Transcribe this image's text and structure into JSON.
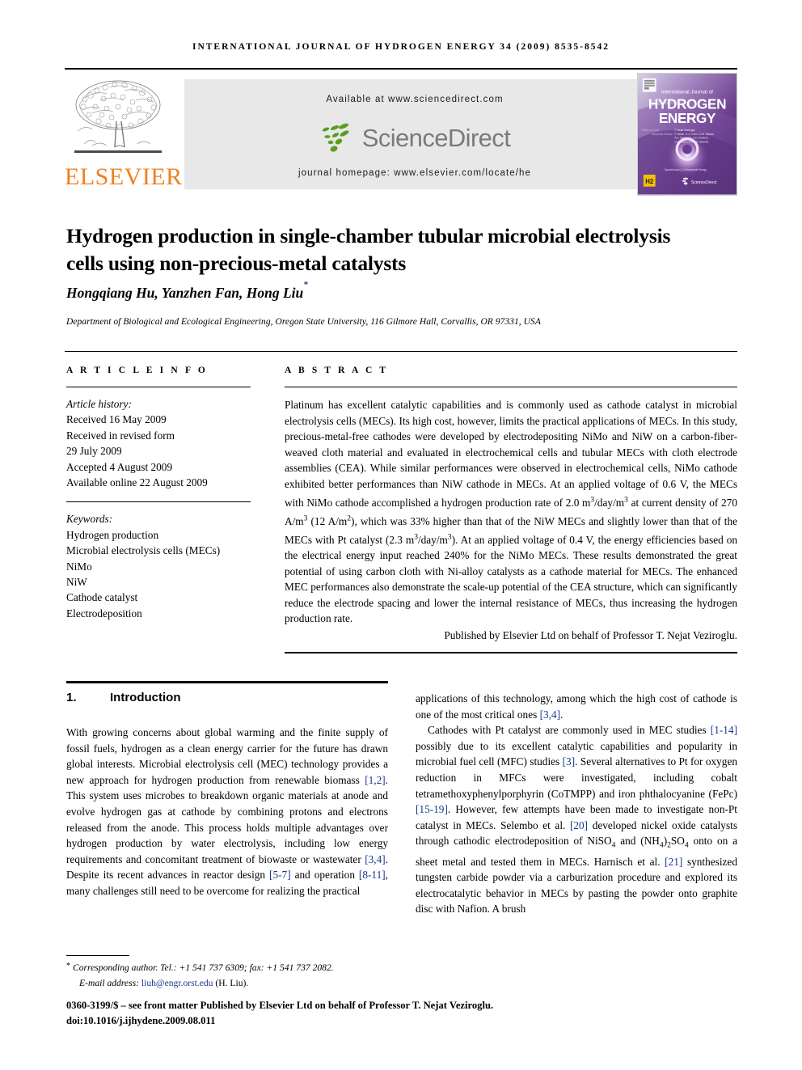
{
  "runhead": "INTERNATIONAL JOURNAL OF HYDROGEN ENERGY 34 (2009) 8535-8542",
  "masthead": {
    "publisher_name": "ELSEVIER",
    "available_at": "Available at www.sciencedirect.com",
    "sciencedirect_word": "ScienceDirect",
    "journal_homepage": "journal homepage: www.elsevier.com/locate/he",
    "cover": {
      "line1": "International Journal of",
      "line2": "HYDROGEN",
      "line3": "ENERGY",
      "editor_label": "Editor-in-Chief:",
      "editor": "T. Nejat Veziroglu",
      "assoc_label": "Associate Editors:",
      "assoc1": "F. Barbir, G.A. Karim, A.M. Mosad,",
      "assoc2": "A.Z. Sandrock, J.M. Norbeck,",
      "assoc3": "G.A. Skarlii and G.A. Ianirollo",
      "badge": "H2",
      "sd_badge": "ScienceDirect",
      "footer_note": "Special Issue 2: A Renewable Energy"
    }
  },
  "article": {
    "title": "Hydrogen production in single-chamber tubular microbial electrolysis cells using non-precious-metal catalysts",
    "authors": "Hongqiang Hu, Yanzhen Fan, Hong Liu",
    "author_marker": "*",
    "affiliation": "Department of Biological and Ecological Engineering, Oregon State University, 116 Gilmore Hall, Corvallis, OR 97331, USA"
  },
  "info": {
    "heading": "A R T I C L E    I N F O",
    "history_label": "Article history:",
    "history": [
      "Received 16 May 2009",
      "Received in revised form",
      "29 July 2009",
      "Accepted 4 August 2009",
      "Available online 22 August 2009"
    ],
    "keywords_label": "Keywords:",
    "keywords": [
      "Hydrogen production",
      "Microbial electrolysis cells (MECs)",
      "NiMo",
      "NiW",
      "Cathode catalyst",
      "Electrodeposition"
    ]
  },
  "abstract": {
    "heading": "A B S T R A C T",
    "text": "Platinum has excellent catalytic capabilities and is commonly used as cathode catalyst in microbial electrolysis cells (MECs). Its high cost, however, limits the practical applications of MECs. In this study, precious-metal-free cathodes were developed by electrodepositing NiMo and NiW on a carbon-fiber-weaved cloth material and evaluated in electrochemical cells and tubular MECs with cloth electrode assemblies (CEA). While similar performances were observed in electrochemical cells, NiMo cathode exhibited better performances than NiW cathode in MECs. At an applied voltage of 0.6 V, the MECs with NiMo cathode accomplished a hydrogen production rate of 2.0 m3/day/m3 at current density of 270 A/m3 (12 A/m2), which was 33% higher than that of the NiW MECs and slightly lower than that of the MECs with Pt catalyst (2.3 m3/day/m3). At an applied voltage of 0.4 V, the energy efficiencies based on the electrical energy input reached 240% for the NiMo MECs. These results demonstrated the great potential of using carbon cloth with Ni-alloy catalysts as a cathode material for MECs. The enhanced MEC performances also demonstrate the scale-up potential of the CEA structure, which can significantly reduce the electrode spacing and lower the internal resistance of MECs, thus increasing the hydrogen production rate.",
    "published_by": "Published by Elsevier Ltd on behalf of Professor T. Nejat Veziroglu."
  },
  "section": {
    "number": "1.",
    "title": "Introduction",
    "left_paragraph": "With growing concerns about global warming and the finite supply of fossil fuels, hydrogen as a clean energy carrier for the future has drawn global interests. Microbial electrolysis cell (MEC) technology provides a new approach for hydrogen production from renewable biomass [1,2]. This system uses microbes to breakdown organic materials at anode and evolve hydrogen gas at cathode by combining protons and electrons released from the anode. This process holds multiple advantages over hydrogen production by water electrolysis, including low energy requirements and concomitant treatment of biowaste or wastewater [3,4]. Despite its recent advances in reactor design [5-7] and operation [8-11], many challenges still need to be overcome for realizing the practical",
    "right_paragraph_1": "applications of this technology, among which the high cost of cathode is one of the most critical ones [3,4].",
    "right_paragraph_2": "Cathodes with Pt catalyst are commonly used in MEC studies [1-14] possibly due to its excellent catalytic capabilities and popularity in microbial fuel cell (MFC) studies [3]. Several alternatives to Pt for oxygen reduction in MFCs were investigated, including cobalt tetramethoxyphenylporphyrin (CoTMPP) and iron phthalocyanine (FePc) [15-19]. However, few attempts have been made to investigate non-Pt catalyst in MECs. Selembo et al. [20] developed nickel oxide catalysts through cathodic electrodeposition of NiSO4 and (NH4)2SO4 onto on a sheet metal and tested them in MECs. Harnisch et al. [21] synthesized tungsten carbide powder via a carburization procedure and explored its electrocatalytic behavior in MECs by pasting the powder onto graphite disc with Nafion. A brush"
  },
  "footer": {
    "corresponding_marker": "*",
    "corresponding": "Corresponding author. Tel.: +1 541 737 6309; fax: +1 541 737 2082.",
    "email_label": "E-mail address:",
    "email": "liuh@engr.orst.edu",
    "email_owner": "(H. Liu).",
    "issn_line": "0360-3199/$ – see front matter Published by Elsevier Ltd on behalf of Professor T. Nejat Veziroglu.",
    "doi_line": "doi:10.1016/j.ijhydene.2009.08.011"
  },
  "colors": {
    "elsevier_orange": "#f08020",
    "sciencedirect_green": "#5a9e20",
    "sciencedirect_gray": "#7a7a7a",
    "reference_blue": "#17388c",
    "banner_gray": "#e8e8e8"
  }
}
